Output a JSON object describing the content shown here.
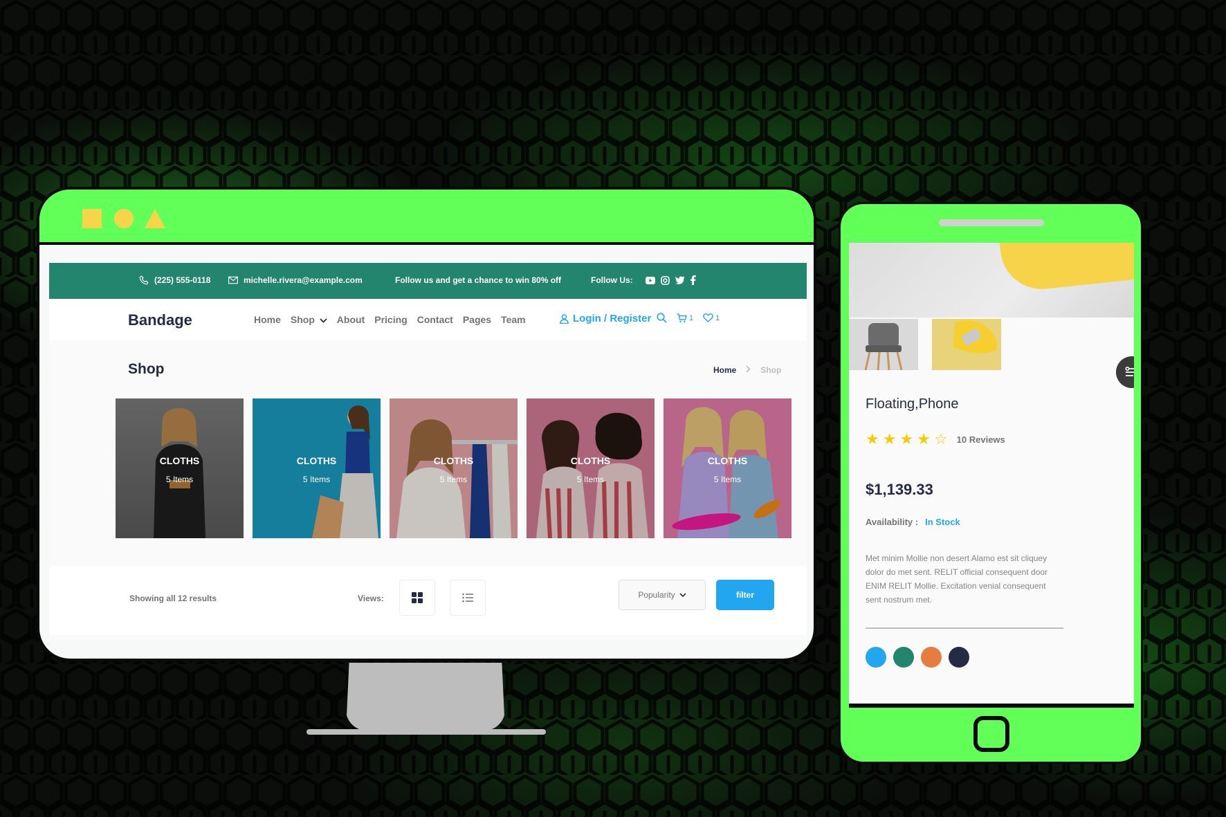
{
  "colors": {
    "accent_green": "#63ff59",
    "topbar_green": "#23856d",
    "primary_blue": "#23a6f0",
    "text_dark": "#252b42",
    "text_gray": "#737373",
    "star_yellow": "#f3cd03"
  },
  "desktop": {
    "topbar": {
      "phone": "(225) 555-0118",
      "email": "michelle.rivera@example.com",
      "promo": "Follow us and get a chance to win 80% off",
      "follow_label": "Follow Us:",
      "social_icons": [
        "youtube-icon",
        "instagram-icon",
        "twitter-icon",
        "facebook-icon"
      ]
    },
    "navbar": {
      "brand": "Bandage",
      "menu": [
        "Home",
        "Shop",
        "About",
        "Pricing",
        "Contact",
        "Pages",
        "Team"
      ],
      "login": "Login / Register",
      "cart_count": "1",
      "wishlist_count": "1"
    },
    "page": {
      "title": "Shop",
      "breadcrumb_home": "Home",
      "breadcrumb_current": "Shop"
    },
    "categories": [
      {
        "title": "CLOTHS",
        "subtitle": "5 Items",
        "bg": "#6f6f6f"
      },
      {
        "title": "CLOTHS",
        "subtitle": "5 Items",
        "bg": "#1b9ac0"
      },
      {
        "title": "CLOTHS",
        "subtitle": "5 Items",
        "bg": "#e6a3a5"
      },
      {
        "title": "CLOTHS",
        "subtitle": "5 Items",
        "bg": "#d27b95"
      },
      {
        "title": "CLOTHS",
        "subtitle": "5 Items",
        "bg": "#e27aa8"
      }
    ],
    "controls": {
      "results": "Showing all 12 results",
      "views_label": "Views:",
      "sort": "Popularity",
      "filter": "filter"
    }
  },
  "mobile": {
    "product_name": "Floating,Phone",
    "rating": 4,
    "rating_max": 5,
    "reviews": "10 Reviews",
    "price": "$1,139.33",
    "availability_label": "Availability :",
    "availability_value": "In Stock",
    "description": "Met minim Mollie non desert Alamo est sit cliquey dolor do met sent. RELIT official consequent door ENIM RELIT Mollie. Excitation venial consequent sent nostrum met.",
    "swatches": [
      "#23a6f0",
      "#23856d",
      "#e77c40",
      "#252b42"
    ]
  }
}
